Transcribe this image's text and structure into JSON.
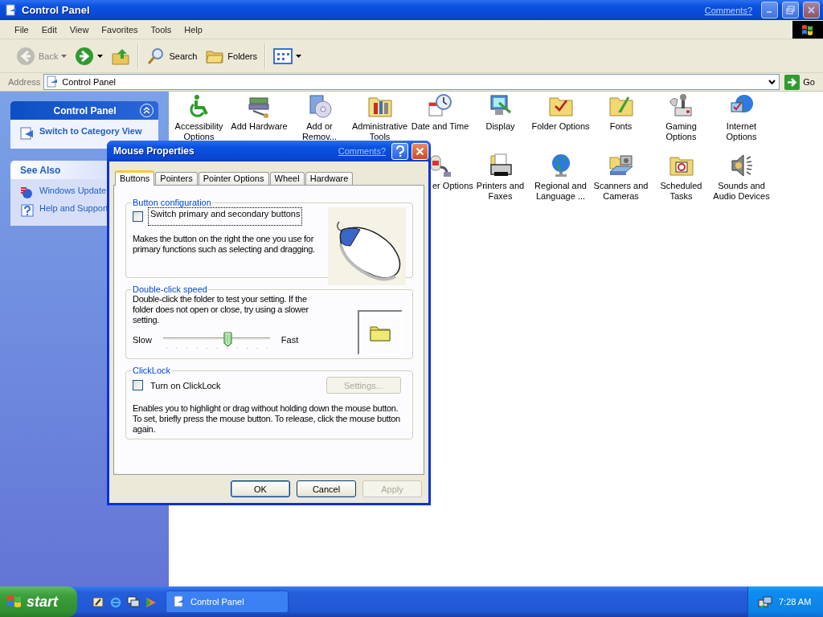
{
  "window": {
    "title": "Control Panel",
    "comments_link": "Comments?"
  },
  "menu_bar": [
    "File",
    "Edit",
    "View",
    "Favorites",
    "Tools",
    "Help"
  ],
  "toolbar": [
    {
      "kind": "back",
      "label": "Back",
      "disabled": true
    },
    {
      "kind": "forward",
      "disabled": false
    },
    {
      "kind": "up",
      "disabled": false
    },
    {
      "kind": "search",
      "label": "Search",
      "disabled": false
    },
    {
      "kind": "folders",
      "label": "Folders",
      "disabled": false
    },
    {
      "kind": "views",
      "disabled": false
    }
  ],
  "address_bar": {
    "label": "Address",
    "value": "Control Panel",
    "go_label": "Go"
  },
  "task_pane": {
    "sections": [
      {
        "kind": "primary",
        "title": "Control Panel",
        "expanded": true,
        "links": [
          "Switch to Category View"
        ]
      },
      {
        "kind": "secondary",
        "title": "See Also",
        "links": [
          "Windows Update",
          "Help and Support"
        ]
      }
    ]
  },
  "icon_rows": [
    [
      "Accessibility Options",
      "Add Hardware",
      "Add or Remov...",
      "Administrative Tools",
      "Date and Time",
      "Display",
      "Folder Options",
      "Fonts",
      "Gaming Options",
      "Internet Options"
    ],
    [
      "er Options",
      "Printers and Faxes",
      "Regional and Language ...",
      "Scanners and Cameras",
      "Scheduled Tasks",
      "Sounds and Audio Devices"
    ]
  ],
  "dialog": {
    "title": "Mouse Properties",
    "comments_link": "Comments?",
    "tabs": [
      {
        "label": "Buttons",
        "selected": true
      },
      {
        "label": "Pointers",
        "selected": false
      },
      {
        "label": "Pointer Options",
        "selected": false
      },
      {
        "label": "Wheel",
        "selected": false
      },
      {
        "label": "Hardware",
        "selected": false
      }
    ],
    "groups": [
      {
        "kind": "buttons",
        "title": "Button configuration",
        "checkbox": {
          "label": "Switch primary and secondary buttons",
          "checked": false,
          "focused": true
        },
        "description": "Makes the button on the right the one you use for primary functions such as selecting and dragging."
      },
      {
        "kind": "speed",
        "title": "Double-click speed",
        "description": "Double-click the folder to test your setting. If the folder does not open or close, try using a slower setting.",
        "slider": {
          "min_label": "Slow",
          "max_label": "Fast",
          "level": 0.6
        }
      },
      {
        "kind": "clicklock",
        "title": "ClickLock",
        "checkbox": {
          "label": "Turn on ClickLock",
          "checked": false,
          "focused": false
        },
        "settings_button": {
          "label": "Settings...",
          "disabled": true
        },
        "description": "Enables you to highlight or drag without holding down the mouse button. To set, briefly press the mouse button. To release, click the mouse button again."
      }
    ],
    "buttons": [
      {
        "label": "OK",
        "disabled": false
      },
      {
        "label": "Cancel",
        "disabled": false
      },
      {
        "label": "Apply",
        "disabled": true
      }
    ]
  },
  "taskbar": {
    "start_label": "start",
    "tasks": [
      {
        "label": "Control Panel",
        "selected": false
      }
    ],
    "clock": "7:28 AM"
  }
}
